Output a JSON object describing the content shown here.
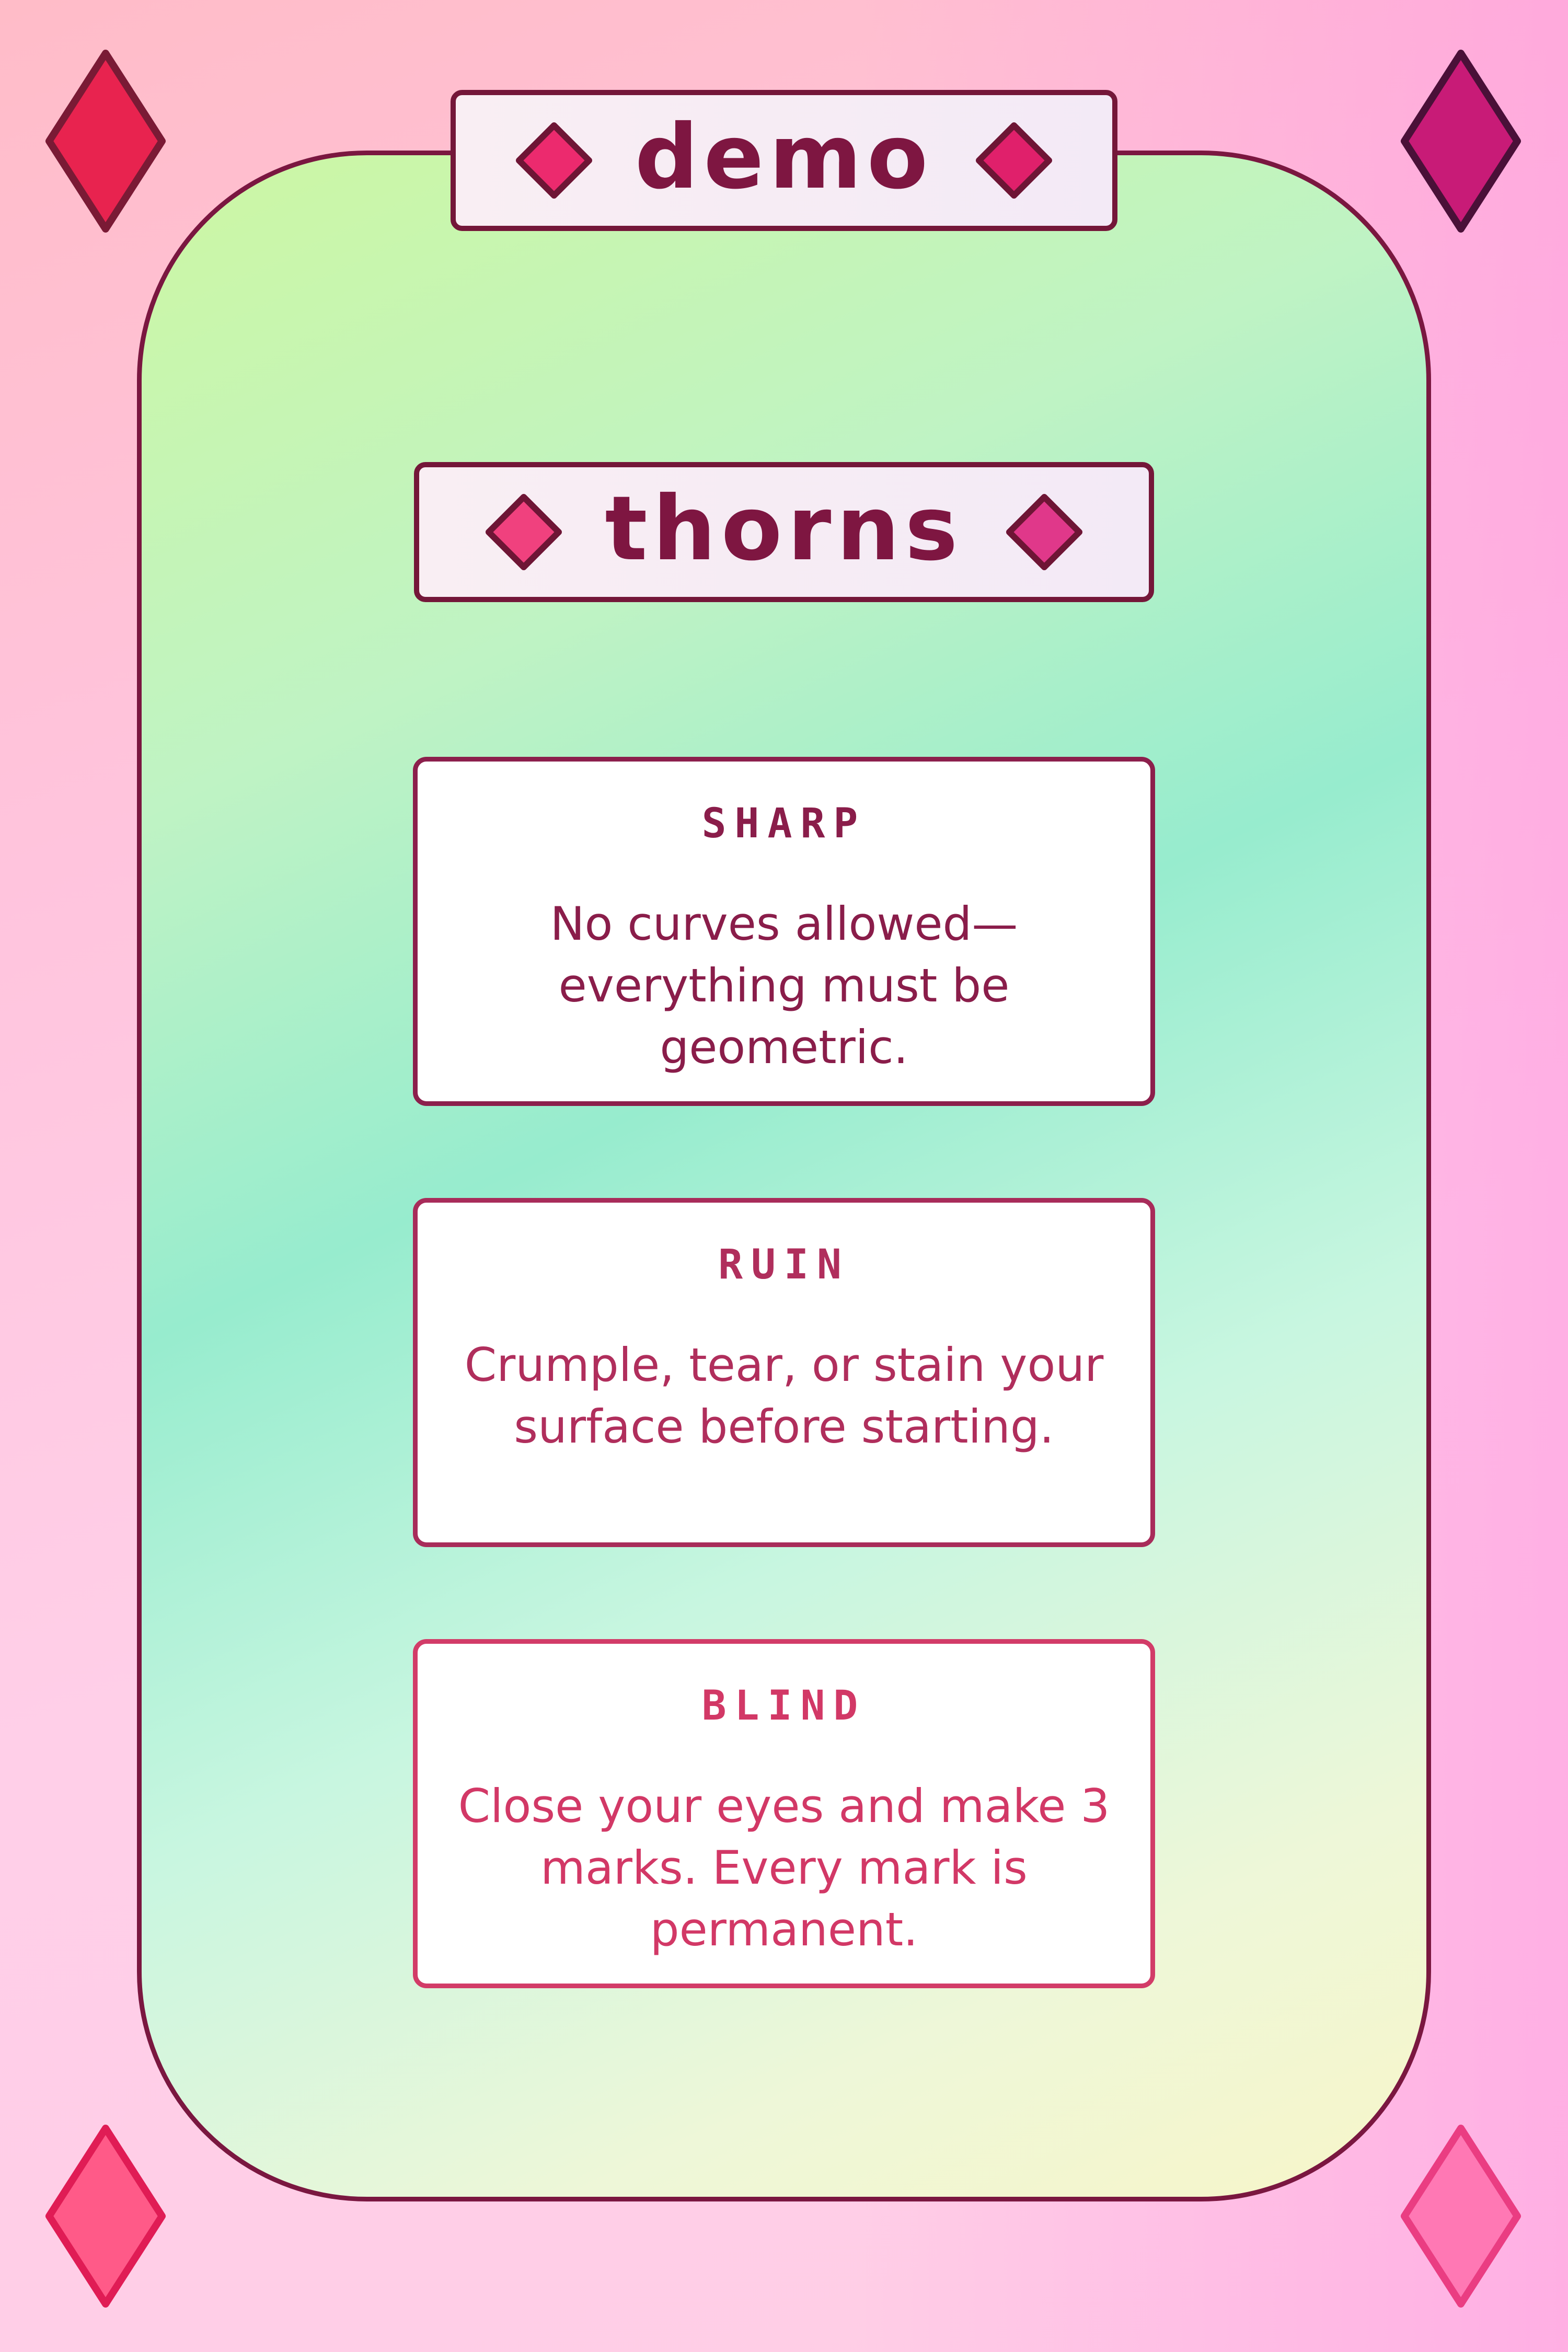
{
  "header": {
    "label": "demo"
  },
  "card": {
    "title": "thorns",
    "rules": [
      {
        "title": "SHARP",
        "text": "No curves allowed—everything must be geometric."
      },
      {
        "title": "RUIN",
        "text": "Crumple, tear, or stain your surface before starting."
      },
      {
        "title": "BLIND",
        "text": "Close your eyes and make 3 marks. Every mark is permanent."
      }
    ]
  },
  "colors": {
    "primary": "#7e1641",
    "accent_pink": "#e9206a",
    "gem_light": "#ff5a93",
    "card_green": "#cdf7a3",
    "card_teal": "#97ecce"
  },
  "icons": {
    "corner": "diamond-gem-icon",
    "banner": "diamond-gem-icon"
  }
}
